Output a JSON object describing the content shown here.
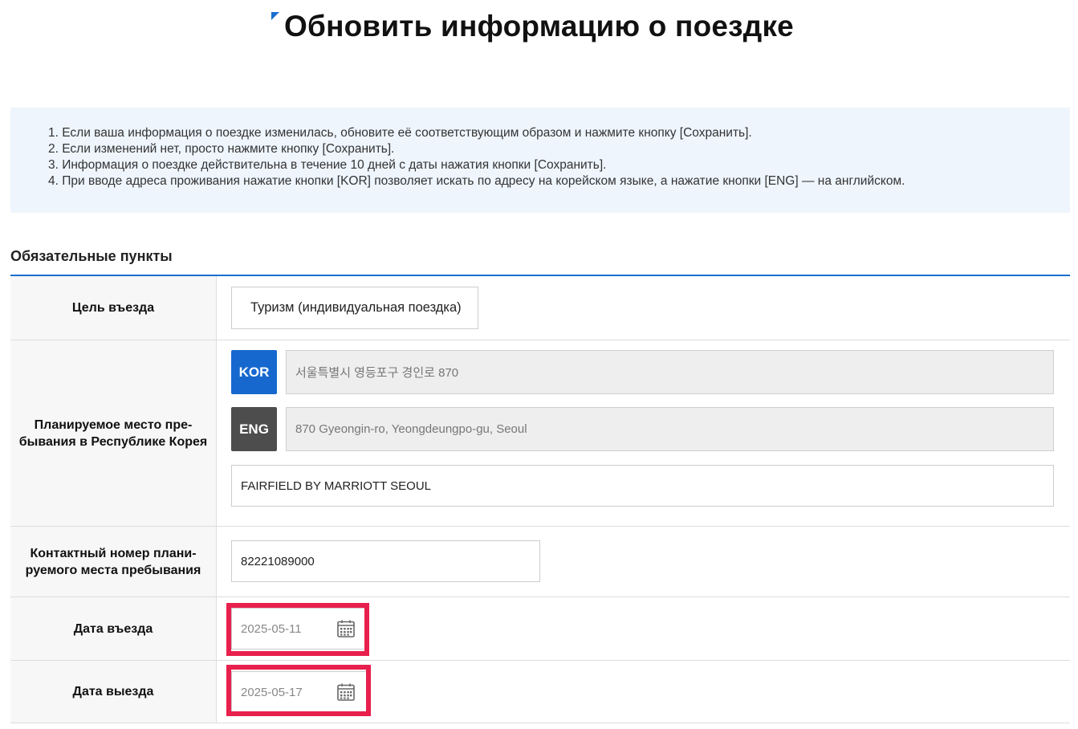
{
  "page": {
    "title": "Обновить информацию о поездке"
  },
  "notice": {
    "items": [
      "1. Если ваша информация о поездке изменилась, обновите её соответствующим образом и нажмите кнопку [Сохранить].",
      "2. Если изменений нет, просто нажмите кнопку [Сохранить].",
      "3. Информация о поездке действительна в течение 10 дней с даты нажатия кнопки [Сохранить].",
      "4. При вводе адреса проживания нажатие кнопки [KOR] позволяет искать по адресу на корейском языке, а нажатие кнопки [ENG] — на английском."
    ]
  },
  "form": {
    "section_title": "Обязательные пункты",
    "purpose": {
      "label": "Цель въезда",
      "value": "Туризм (индивидуальная поездка)"
    },
    "stay": {
      "label": "Планируемое место пре-бывания в Республике Корея",
      "kor_button": "KOR",
      "eng_button": "ENG",
      "kor_address": "서울특별시 영등포구 경인로 870",
      "eng_address": "870 Gyeongin-ro, Yeongdeungpo-gu, Seoul",
      "place_name": "FAIRFIELD BY MARRIOTT SEOUL"
    },
    "contact": {
      "label": "Контактный номер плани-руемого места пребывания",
      "value": "82221089000"
    },
    "entry_date": {
      "label": "Дата въезда",
      "value": "2025-05-11"
    },
    "exit_date": {
      "label": "Дата выезда",
      "value": "2025-05-17"
    }
  },
  "colors": {
    "accent": "#1a6fcf",
    "kor_button": "#1668cf",
    "eng_button": "#4d4d4d",
    "highlight": "#e8204d",
    "notice_bg": "#eef5fd"
  },
  "icons": {
    "date_picker": "calendar-icon"
  }
}
